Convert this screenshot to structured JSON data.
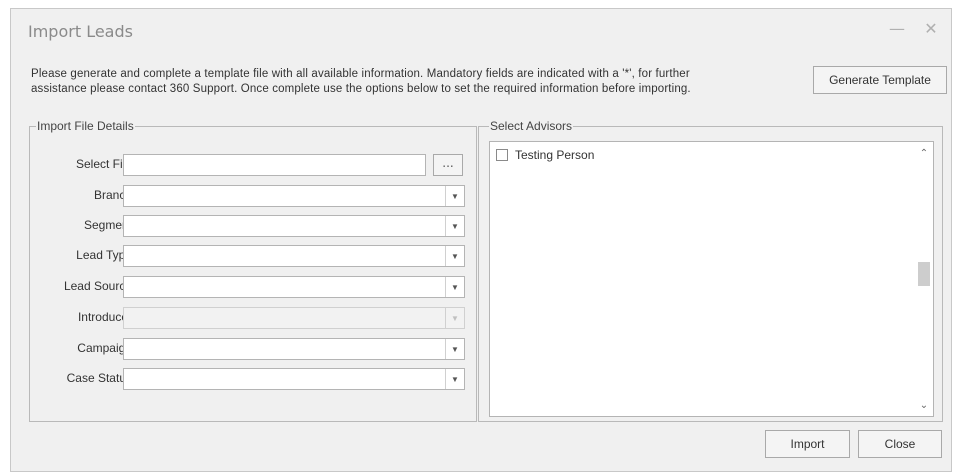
{
  "window": {
    "title": "Import Leads",
    "minimize": "—",
    "close": "✕"
  },
  "instructions": {
    "line1": "Please generate and complete a template file with all available information. Mandatory fields are indicated with a '*', for further",
    "line2": "assistance please contact 360 Support. Once complete use the options below to set the required information before importing."
  },
  "buttons": {
    "generate_template": "Generate Template",
    "browse": "...",
    "import": "Import",
    "close": "Close"
  },
  "import_file_details": {
    "legend": "Import File Details",
    "fields": {
      "select_file": {
        "label": "Select File",
        "value": ""
      },
      "branch": {
        "label": "Branch",
        "value": ""
      },
      "segment": {
        "label": "Segment",
        "value": ""
      },
      "lead_type": {
        "label": "Lead Type",
        "value": ""
      },
      "lead_source": {
        "label": "Lead Source",
        "value": ""
      },
      "introducer": {
        "label": "Introducer",
        "value": "",
        "disabled": true
      },
      "campaign": {
        "label": "Campaign",
        "value": ""
      },
      "case_status": {
        "label": "Case Status",
        "value": ""
      }
    }
  },
  "select_advisors": {
    "legend": "Select Advisors",
    "items": [
      {
        "label": "Testing Person",
        "checked": false
      }
    ]
  },
  "icons": {
    "dropdown": "chevron-down-icon",
    "scroll_up": "chevron-up-icon",
    "scroll_down": "chevron-down-icon"
  }
}
